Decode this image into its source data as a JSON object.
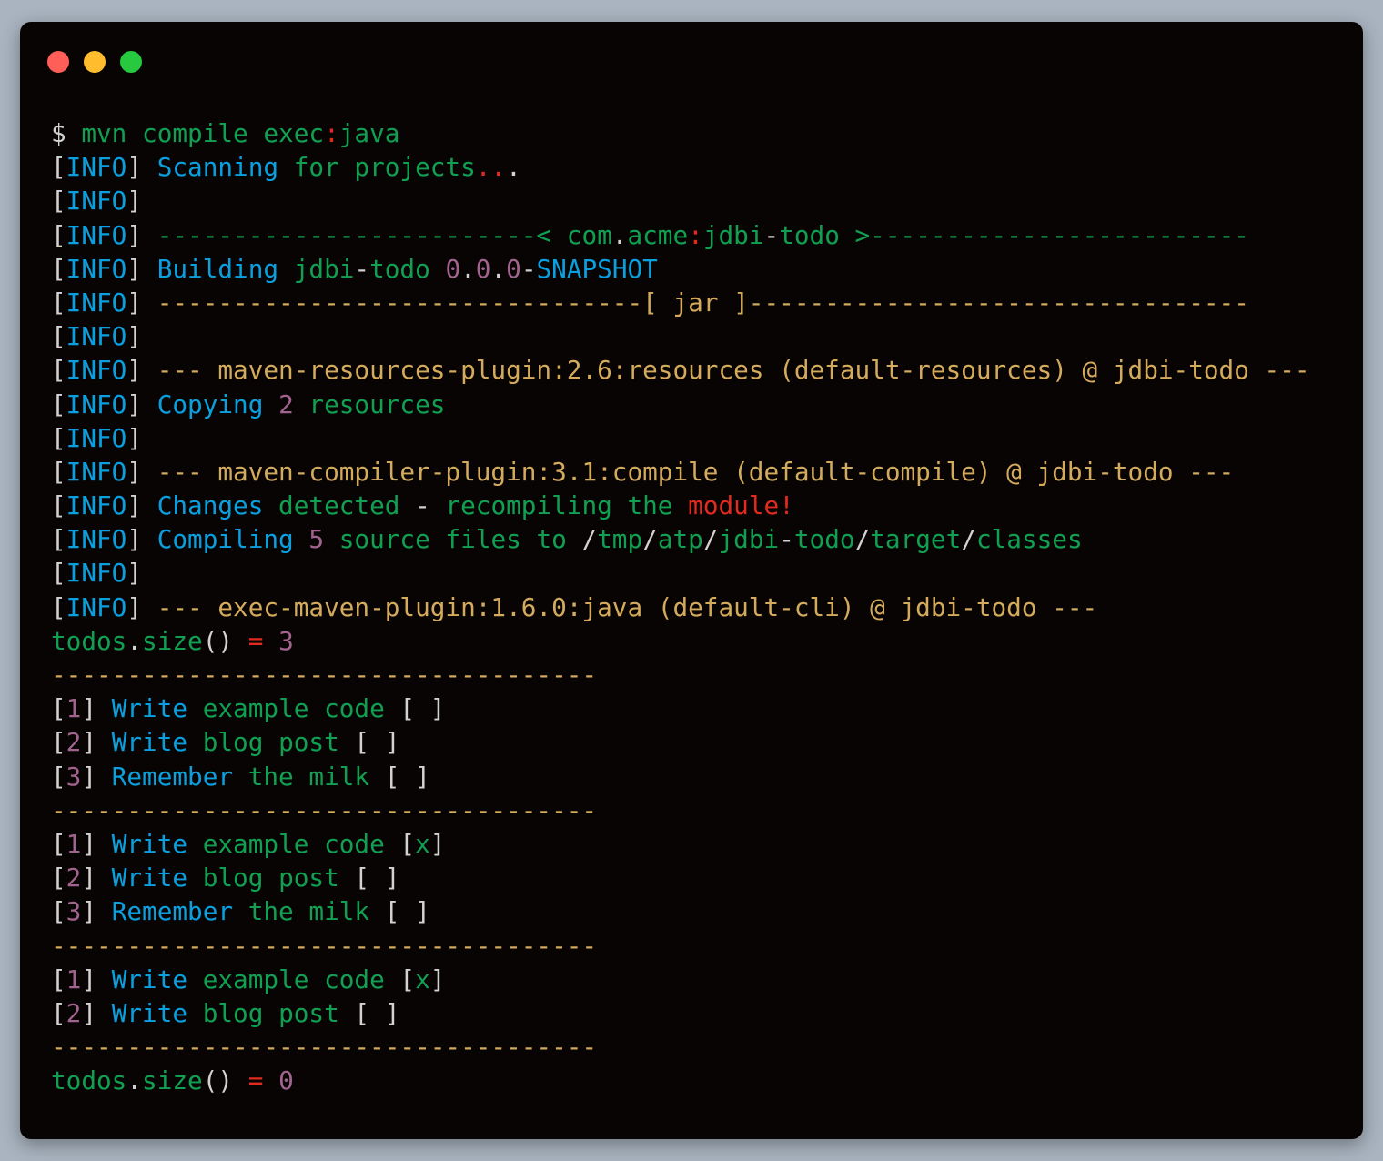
{
  "window": {
    "controls": [
      "close",
      "minimize",
      "maximize"
    ]
  },
  "colors": {
    "w": "#d2d2d2",
    "b": "#0a9fdf",
    "g": "#11a052",
    "p": "#a2638f",
    "r": "#e22a1f",
    "y": "#d4ab5c",
    "background": "#080403"
  },
  "lines": [
    [
      [
        "$ ",
        "w"
      ],
      [
        "mvn compile exec",
        "g"
      ],
      [
        ":",
        "r"
      ],
      [
        "java",
        "g"
      ]
    ],
    [
      [
        "[",
        "w"
      ],
      [
        "INFO",
        "b"
      ],
      [
        "] ",
        "w"
      ],
      [
        "Scanning",
        "b"
      ],
      [
        " for projects",
        "g"
      ],
      [
        "..",
        "r"
      ],
      [
        ".",
        "w"
      ]
    ],
    [
      [
        "[",
        "w"
      ],
      [
        "INFO",
        "b"
      ],
      [
        "]",
        "w"
      ]
    ],
    [
      [
        "[",
        "w"
      ],
      [
        "INFO",
        "b"
      ],
      [
        "] ",
        "w"
      ],
      [
        "-------------------------< com",
        "g"
      ],
      [
        ".",
        "w"
      ],
      [
        "acme",
        "g"
      ],
      [
        ":",
        "r"
      ],
      [
        "jdbi",
        "g"
      ],
      [
        "-",
        "w"
      ],
      [
        "todo >-------------------------",
        "g"
      ]
    ],
    [
      [
        "[",
        "w"
      ],
      [
        "INFO",
        "b"
      ],
      [
        "] ",
        "w"
      ],
      [
        "Building",
        "b"
      ],
      [
        " jdbi",
        "g"
      ],
      [
        "-",
        "w"
      ],
      [
        "todo ",
        "g"
      ],
      [
        "0",
        "p"
      ],
      [
        ".",
        "w"
      ],
      [
        "0",
        "p"
      ],
      [
        ".",
        "w"
      ],
      [
        "0",
        "p"
      ],
      [
        "-",
        "w"
      ],
      [
        "SNAPSHOT",
        "b"
      ]
    ],
    [
      [
        "[",
        "w"
      ],
      [
        "INFO",
        "b"
      ],
      [
        "] ",
        "w"
      ],
      [
        "--------------------------------[ jar ]---------------------------------",
        "y"
      ]
    ],
    [
      [
        "[",
        "w"
      ],
      [
        "INFO",
        "b"
      ],
      [
        "]",
        "w"
      ]
    ],
    [
      [
        "[",
        "w"
      ],
      [
        "INFO",
        "b"
      ],
      [
        "] ",
        "w"
      ],
      [
        "--- maven-resources-plugin:2.6:resources (default-resources) @ jdbi-todo ---",
        "y"
      ]
    ],
    [
      [
        "[",
        "w"
      ],
      [
        "INFO",
        "b"
      ],
      [
        "] ",
        "w"
      ],
      [
        "Copying",
        "b"
      ],
      [
        " ",
        "w"
      ],
      [
        "2",
        "p"
      ],
      [
        " resources",
        "g"
      ]
    ],
    [
      [
        "[",
        "w"
      ],
      [
        "INFO",
        "b"
      ],
      [
        "]",
        "w"
      ]
    ],
    [
      [
        "[",
        "w"
      ],
      [
        "INFO",
        "b"
      ],
      [
        "] ",
        "w"
      ],
      [
        "--- maven-compiler-plugin:3.1:compile (default-compile) @ jdbi-todo ---",
        "y"
      ]
    ],
    [
      [
        "[",
        "w"
      ],
      [
        "INFO",
        "b"
      ],
      [
        "] ",
        "w"
      ],
      [
        "Changes",
        "b"
      ],
      [
        " detected ",
        "g"
      ],
      [
        "-",
        "w"
      ],
      [
        " recompiling the ",
        "g"
      ],
      [
        "module!",
        "r"
      ]
    ],
    [
      [
        "[",
        "w"
      ],
      [
        "INFO",
        "b"
      ],
      [
        "] ",
        "w"
      ],
      [
        "Compiling",
        "b"
      ],
      [
        " ",
        "w"
      ],
      [
        "5",
        "p"
      ],
      [
        " source files to ",
        "g"
      ],
      [
        "/",
        "w"
      ],
      [
        "tmp",
        "g"
      ],
      [
        "/",
        "w"
      ],
      [
        "atp",
        "g"
      ],
      [
        "/",
        "w"
      ],
      [
        "jdbi",
        "g"
      ],
      [
        "-",
        "w"
      ],
      [
        "todo",
        "g"
      ],
      [
        "/",
        "w"
      ],
      [
        "target",
        "g"
      ],
      [
        "/",
        "w"
      ],
      [
        "classes",
        "g"
      ]
    ],
    [
      [
        "[",
        "w"
      ],
      [
        "INFO",
        "b"
      ],
      [
        "]",
        "w"
      ]
    ],
    [
      [
        "[",
        "w"
      ],
      [
        "INFO",
        "b"
      ],
      [
        "] ",
        "w"
      ],
      [
        "--- exec-maven-plugin:1.6.0:java (default-cli) @ jdbi-todo ---",
        "y"
      ]
    ],
    [
      [
        "todos",
        "g"
      ],
      [
        ".",
        "w"
      ],
      [
        "size",
        "g"
      ],
      [
        "() ",
        "w"
      ],
      [
        "=",
        "r"
      ],
      [
        " ",
        "w"
      ],
      [
        "3",
        "p"
      ]
    ],
    [
      [
        "------------------------------------",
        "y"
      ]
    ],
    [
      [
        "[",
        "w"
      ],
      [
        "1",
        "p"
      ],
      [
        "] ",
        "w"
      ],
      [
        "Write",
        "b"
      ],
      [
        " example code ",
        "g"
      ],
      [
        "[ ]",
        "w"
      ]
    ],
    [
      [
        "[",
        "w"
      ],
      [
        "2",
        "p"
      ],
      [
        "] ",
        "w"
      ],
      [
        "Write",
        "b"
      ],
      [
        " blog post ",
        "g"
      ],
      [
        "[ ]",
        "w"
      ]
    ],
    [
      [
        "[",
        "w"
      ],
      [
        "3",
        "p"
      ],
      [
        "] ",
        "w"
      ],
      [
        "Remember",
        "b"
      ],
      [
        " the milk ",
        "g"
      ],
      [
        "[ ]",
        "w"
      ]
    ],
    [
      [
        "------------------------------------",
        "y"
      ]
    ],
    [
      [
        "[",
        "w"
      ],
      [
        "1",
        "p"
      ],
      [
        "] ",
        "w"
      ],
      [
        "Write",
        "b"
      ],
      [
        " example code ",
        "g"
      ],
      [
        "[",
        "w"
      ],
      [
        "x",
        "g"
      ],
      [
        "]",
        "w"
      ]
    ],
    [
      [
        "[",
        "w"
      ],
      [
        "2",
        "p"
      ],
      [
        "] ",
        "w"
      ],
      [
        "Write",
        "b"
      ],
      [
        " blog post ",
        "g"
      ],
      [
        "[ ]",
        "w"
      ]
    ],
    [
      [
        "[",
        "w"
      ],
      [
        "3",
        "p"
      ],
      [
        "] ",
        "w"
      ],
      [
        "Remember",
        "b"
      ],
      [
        " the milk ",
        "g"
      ],
      [
        "[ ]",
        "w"
      ]
    ],
    [
      [
        "------------------------------------",
        "y"
      ]
    ],
    [
      [
        "[",
        "w"
      ],
      [
        "1",
        "p"
      ],
      [
        "] ",
        "w"
      ],
      [
        "Write",
        "b"
      ],
      [
        " example code ",
        "g"
      ],
      [
        "[",
        "w"
      ],
      [
        "x",
        "g"
      ],
      [
        "]",
        "w"
      ]
    ],
    [
      [
        "[",
        "w"
      ],
      [
        "2",
        "p"
      ],
      [
        "] ",
        "w"
      ],
      [
        "Write",
        "b"
      ],
      [
        " blog post ",
        "g"
      ],
      [
        "[ ]",
        "w"
      ]
    ],
    [
      [
        "------------------------------------",
        "y"
      ]
    ],
    [
      [
        "todos",
        "g"
      ],
      [
        ".",
        "w"
      ],
      [
        "size",
        "g"
      ],
      [
        "() ",
        "w"
      ],
      [
        "=",
        "r"
      ],
      [
        " ",
        "w"
      ],
      [
        "0",
        "p"
      ]
    ]
  ]
}
